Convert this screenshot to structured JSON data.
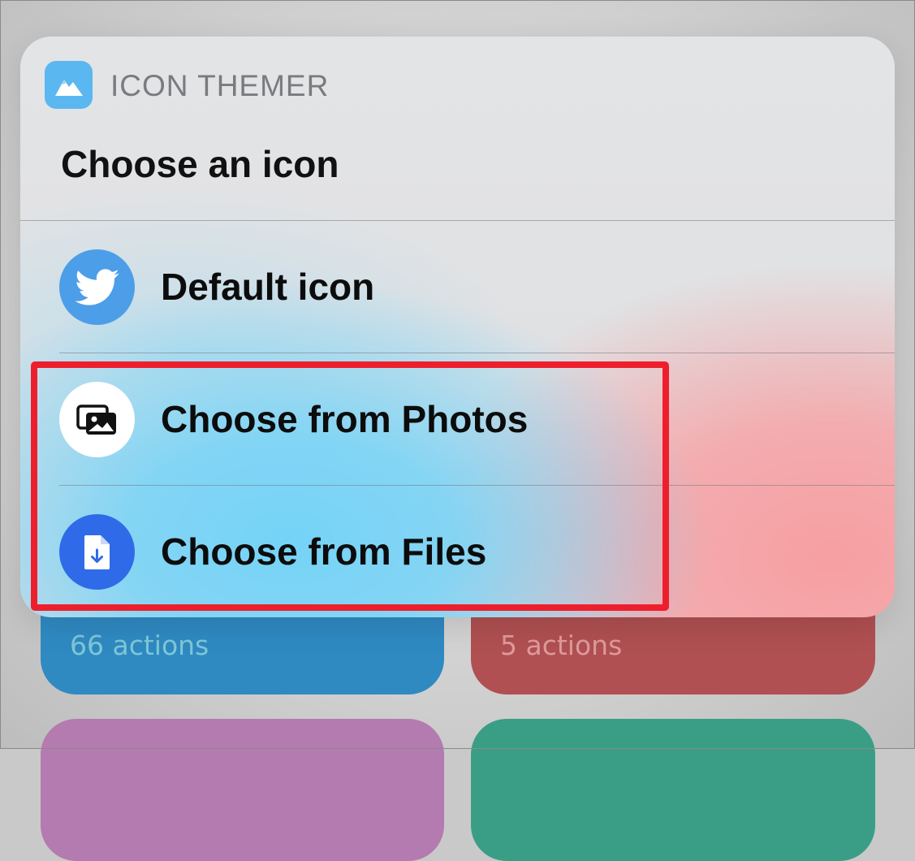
{
  "background_tiles": [
    {
      "label": "66 actions",
      "color": "#2f8ac2"
    },
    {
      "label": "5 actions",
      "color": "#b05052"
    },
    {
      "label": "",
      "color": "#b47bb0"
    },
    {
      "label": "",
      "color": "#3a9e86"
    }
  ],
  "menu": {
    "app_name": "ICON THEMER",
    "app_icon": "mountain-icon",
    "title": "Choose an icon",
    "options": [
      {
        "label": "Default icon",
        "icon": "twitter-bird-icon",
        "icon_color": "#4d9ee8"
      },
      {
        "label": "Choose from Photos",
        "icon": "photos-icon",
        "icon_color": "#ffffff"
      },
      {
        "label": "Choose from Files",
        "icon": "file-download-icon",
        "icon_color": "#2f6be8"
      }
    ]
  },
  "annotation": {
    "highlight_color": "#ee1f2d"
  }
}
